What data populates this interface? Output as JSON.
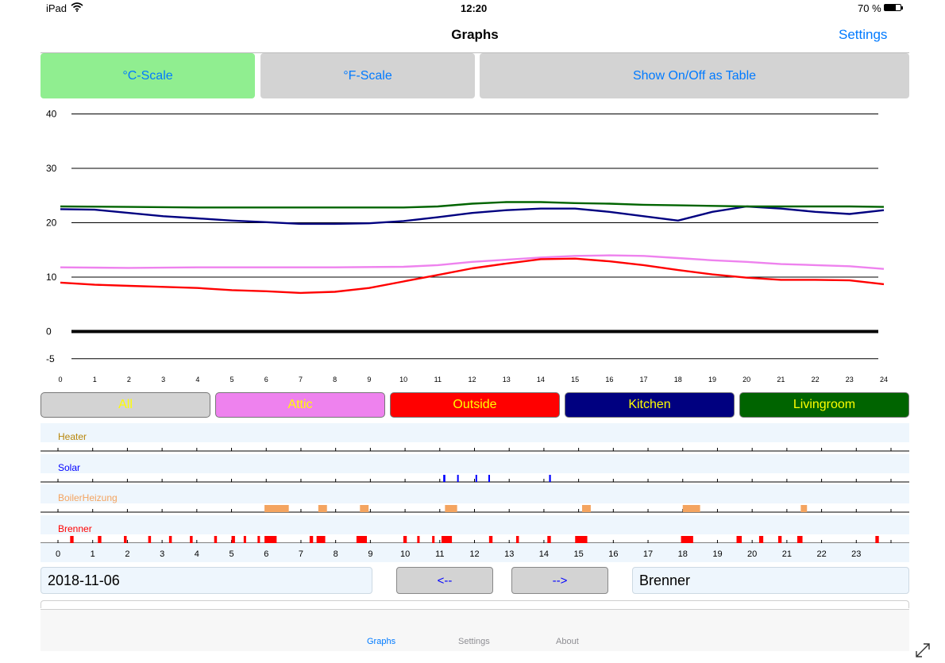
{
  "status_bar": {
    "device": "iPad",
    "time": "12:20",
    "battery": "70 %"
  },
  "nav": {
    "title": "Graphs",
    "settings": "Settings"
  },
  "scale_buttons": {
    "celsius": "°C-Scale",
    "fahrenheit": "°F-Scale",
    "table": "Show On/Off as Table"
  },
  "colors": {
    "attic": "#ee82ee",
    "outside": "#ff0000",
    "kitchen": "#000080",
    "livingroom": "#006400",
    "heater": "#b8860b",
    "solar": "#0000ff",
    "boiler": "#f4a460",
    "brenner": "#ff0000",
    "selected_scale": "#90ee90",
    "accent": "#007aff"
  },
  "chart_data": [
    {
      "type": "line",
      "x_ticks": [
        "0",
        "1",
        "2",
        "3",
        "4",
        "5",
        "6",
        "7",
        "8",
        "9",
        "10",
        "11",
        "12",
        "13",
        "14",
        "15",
        "16",
        "17",
        "18",
        "19",
        "20",
        "21",
        "22",
        "23",
        "24"
      ],
      "y_ticks": [
        "40",
        "30",
        "20",
        "10",
        "0",
        "-5"
      ],
      "ylim": [
        -5,
        40
      ],
      "xlim": [
        0,
        24
      ],
      "grid": true,
      "series": [
        {
          "name": "Attic",
          "color": "#ee82ee",
          "x": [
            0,
            2,
            4,
            6,
            8,
            10,
            11,
            12,
            13,
            14,
            15,
            16,
            17,
            18,
            19,
            20,
            21,
            22,
            23,
            24
          ],
          "y": [
            11.8,
            11.7,
            11.8,
            11.8,
            11.8,
            11.9,
            12.2,
            12.8,
            13.2,
            13.6,
            13.9,
            14.0,
            13.9,
            13.5,
            13.1,
            12.8,
            12.4,
            12.2,
            12.0,
            11.5
          ]
        },
        {
          "name": "Outside",
          "color": "#ff0000",
          "x": [
            0,
            1,
            2,
            3,
            4,
            5,
            6,
            7,
            8,
            9,
            10,
            11,
            12,
            13,
            14,
            15,
            16,
            17,
            18,
            19,
            20,
            21,
            22,
            23,
            24
          ],
          "y": [
            9.0,
            8.6,
            8.4,
            8.2,
            8.0,
            7.6,
            7.4,
            7.1,
            7.3,
            8.0,
            9.2,
            10.4,
            11.6,
            12.5,
            13.3,
            13.4,
            12.9,
            12.2,
            11.3,
            10.5,
            9.9,
            9.5,
            9.5,
            9.4,
            8.7
          ]
        },
        {
          "name": "Kitchen",
          "color": "#000080",
          "x": [
            0,
            1,
            2,
            3,
            4,
            5,
            6,
            7,
            8,
            9,
            10,
            11,
            12,
            13,
            14,
            15,
            16,
            17,
            18,
            19,
            20,
            21,
            22,
            23,
            24
          ],
          "y": [
            22.5,
            22.4,
            21.8,
            21.2,
            20.8,
            20.4,
            20.1,
            19.8,
            19.8,
            19.9,
            20.3,
            21.0,
            21.8,
            22.3,
            22.6,
            22.6,
            22.0,
            21.2,
            20.4,
            22.0,
            23.0,
            22.6,
            22.0,
            21.6,
            22.3
          ]
        },
        {
          "name": "Livingroom",
          "color": "#006400",
          "x": [
            0,
            2,
            4,
            6,
            8,
            10,
            11,
            12,
            13,
            14,
            15,
            16,
            17,
            18,
            19,
            20,
            21,
            22,
            23,
            24
          ],
          "y": [
            23.0,
            22.9,
            22.8,
            22.8,
            22.8,
            22.8,
            23.0,
            23.5,
            23.8,
            23.8,
            23.6,
            23.5,
            23.3,
            23.2,
            23.1,
            23.0,
            23.0,
            23.0,
            23.0,
            22.9
          ]
        }
      ]
    },
    {
      "type": "timeline",
      "x_ticks": [
        "0",
        "1",
        "2",
        "3",
        "4",
        "5",
        "6",
        "7",
        "8",
        "9",
        "10",
        "11",
        "12",
        "13",
        "14",
        "15",
        "16",
        "17",
        "18",
        "19",
        "20",
        "21",
        "22",
        "23"
      ],
      "xlim": [
        0,
        24
      ],
      "series": [
        {
          "name": "Heater",
          "color": "#b8860b",
          "intervals": []
        },
        {
          "name": "Solar",
          "color": "#0000ff",
          "intervals": [
            [
              11.1,
              11.16
            ],
            [
              11.5,
              11.53
            ],
            [
              12.03,
              12.07
            ],
            [
              12.4,
              12.42
            ],
            [
              14.15,
              14.2
            ]
          ]
        },
        {
          "name": "BoilerHeizung",
          "color": "#f4a460",
          "intervals": [
            [
              5.95,
              6.65
            ],
            [
              7.5,
              7.75
            ],
            [
              8.7,
              8.95
            ],
            [
              11.15,
              11.5
            ],
            [
              15.1,
              15.35
            ],
            [
              18.0,
              18.5
            ],
            [
              21.4,
              21.58
            ]
          ]
        },
        {
          "name": "Brenner",
          "color": "#ff0000",
          "intervals": [
            [
              0.35,
              0.45
            ],
            [
              1.15,
              1.25
            ],
            [
              1.9,
              1.98
            ],
            [
              2.6,
              2.68
            ],
            [
              3.2,
              3.28
            ],
            [
              3.8,
              3.88
            ],
            [
              4.5,
              4.58
            ],
            [
              5.0,
              5.1
            ],
            [
              5.35,
              5.42
            ],
            [
              5.75,
              5.82
            ],
            [
              5.95,
              6.3
            ],
            [
              7.25,
              7.35
            ],
            [
              7.45,
              7.7
            ],
            [
              8.6,
              8.9
            ],
            [
              9.95,
              10.05
            ],
            [
              10.35,
              10.42
            ],
            [
              10.78,
              10.85
            ],
            [
              11.05,
              11.35
            ],
            [
              12.42,
              12.52
            ],
            [
              13.2,
              13.28
            ],
            [
              14.1,
              14.2
            ],
            [
              14.9,
              15.25
            ],
            [
              17.95,
              18.3
            ],
            [
              19.55,
              19.7
            ],
            [
              20.2,
              20.32
            ],
            [
              20.75,
              20.85
            ],
            [
              21.3,
              21.45
            ],
            [
              23.55,
              23.65
            ]
          ]
        }
      ]
    }
  ],
  "legend_buttons": {
    "all": "All",
    "attic": "Attic",
    "outside": "Outside",
    "kitchen": "Kitchen",
    "livingroom": "Livingroom"
  },
  "date_field": {
    "value": "2018-11-06"
  },
  "prev_label": "<--",
  "next_label": "-->",
  "device_field": {
    "value": "Brenner"
  },
  "tabs": {
    "graphs": "Graphs",
    "settings": "Settings",
    "about": "About"
  }
}
